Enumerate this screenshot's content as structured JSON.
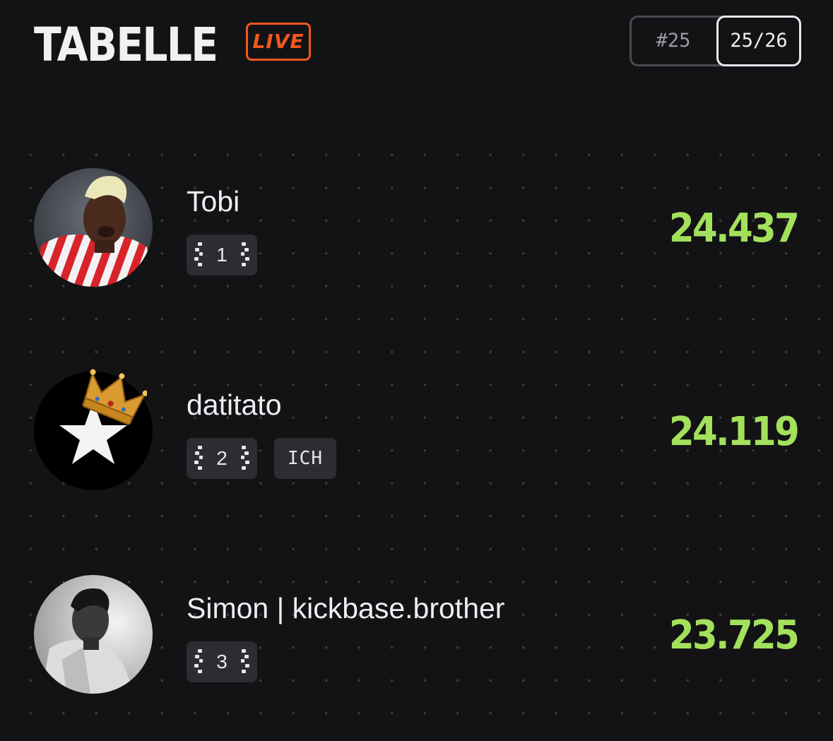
{
  "header": {
    "title": "TABELLE",
    "live_label": "LIVE",
    "matchday_label": "#25",
    "season_label": "25/26"
  },
  "colors": {
    "background": "#131316",
    "live_accent": "#f0571d",
    "points": "#a3e05c",
    "chip_background": "#2c2c31"
  },
  "standings": [
    {
      "rank": "1",
      "name": "Tobi",
      "points": "24.437",
      "tag": null,
      "avatar": "player-photo"
    },
    {
      "rank": "2",
      "name": "datitato",
      "points": "24.119",
      "tag": "ICH",
      "avatar": "star-icon",
      "crown": true
    },
    {
      "rank": "3",
      "name": "Simon | kickbase.brother",
      "points": "23.725",
      "tag": null,
      "avatar": "player-photo-grayscale"
    }
  ]
}
